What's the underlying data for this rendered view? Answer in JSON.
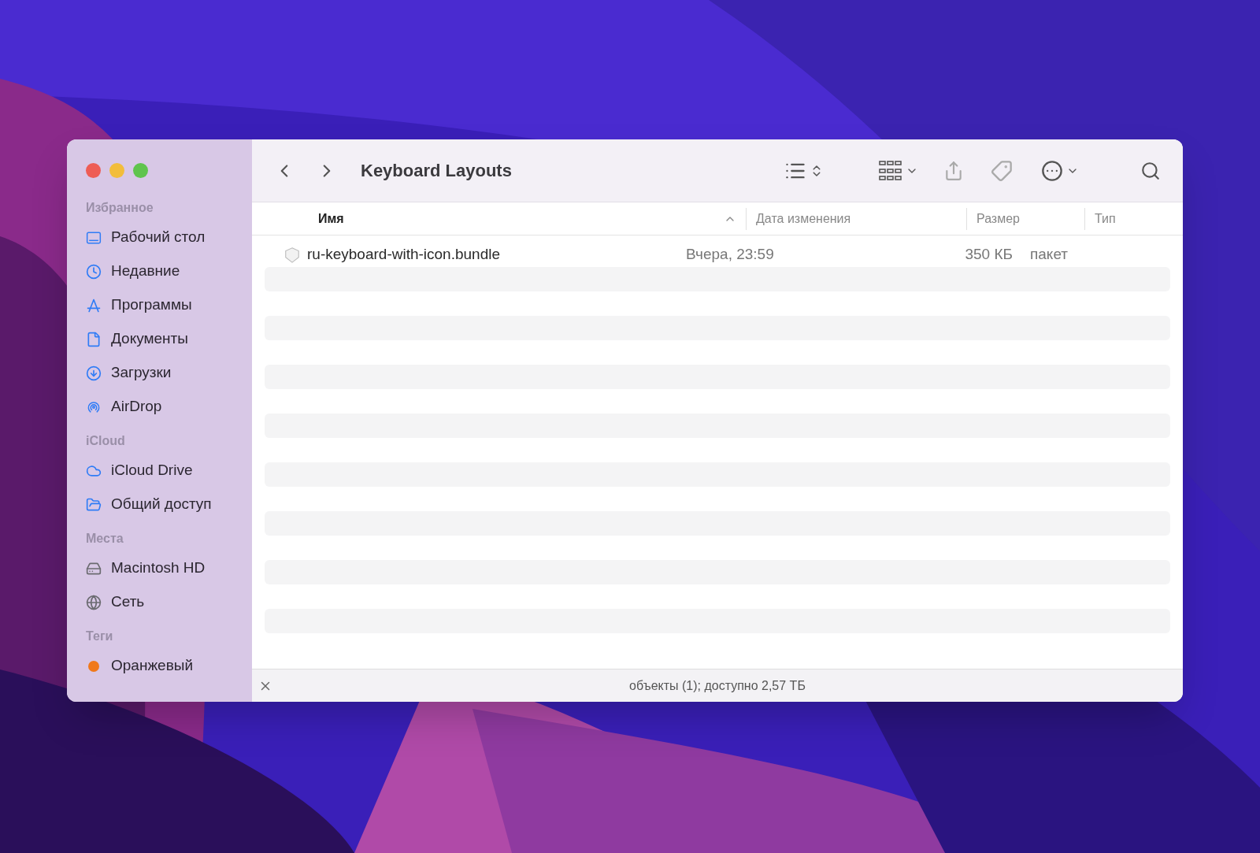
{
  "window": {
    "title": "Keyboard Layouts"
  },
  "sidebar": {
    "sections": [
      {
        "title": "Избранное",
        "items": [
          {
            "label": "Рабочий стол"
          },
          {
            "label": "Недавние"
          },
          {
            "label": "Программы"
          },
          {
            "label": "Документы"
          },
          {
            "label": "Загрузки"
          },
          {
            "label": "AirDrop"
          }
        ]
      },
      {
        "title": "iCloud",
        "items": [
          {
            "label": "iCloud Drive"
          },
          {
            "label": "Общий доступ"
          }
        ]
      },
      {
        "title": "Места",
        "items": [
          {
            "label": "Macintosh HD"
          },
          {
            "label": "Сеть"
          }
        ]
      },
      {
        "title": "Теги",
        "items": [
          {
            "label": "Оранжевый",
            "color": "#f0791b"
          }
        ]
      }
    ]
  },
  "table": {
    "columns": [
      {
        "label": "Имя",
        "sorted": true
      },
      {
        "label": "Дата изменения",
        "sorted": false
      },
      {
        "label": "Размер",
        "sorted": false
      },
      {
        "label": "Тип",
        "sorted": false
      }
    ],
    "rows": [
      {
        "name": "ru-keyboard-with-icon.bundle",
        "date": "Вчера, 23:59",
        "size": "350 КБ",
        "type": "пакет"
      }
    ]
  },
  "status_bar": "объекты (1); доступно 2,57 ТБ"
}
